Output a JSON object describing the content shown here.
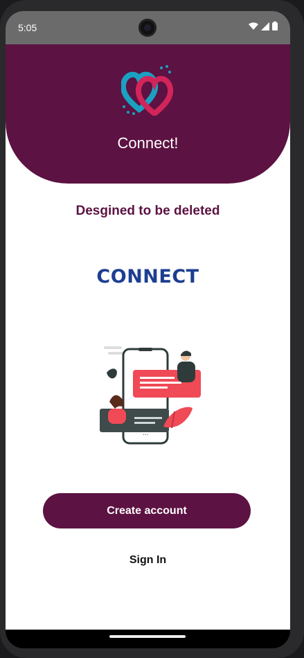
{
  "status_bar": {
    "time": "5:05"
  },
  "header": {
    "app_title": "Connect!"
  },
  "main": {
    "subtitle": "Desgined to be deleted",
    "brand_text": "CONNECT"
  },
  "actions": {
    "create_account_label": "Create account",
    "sign_in_label": "Sign In"
  },
  "colors": {
    "primary": "#5c1242",
    "brand_blue": "#1d3f91",
    "logo_cyan": "#1aa1c2",
    "logo_pink": "#d2255a"
  }
}
